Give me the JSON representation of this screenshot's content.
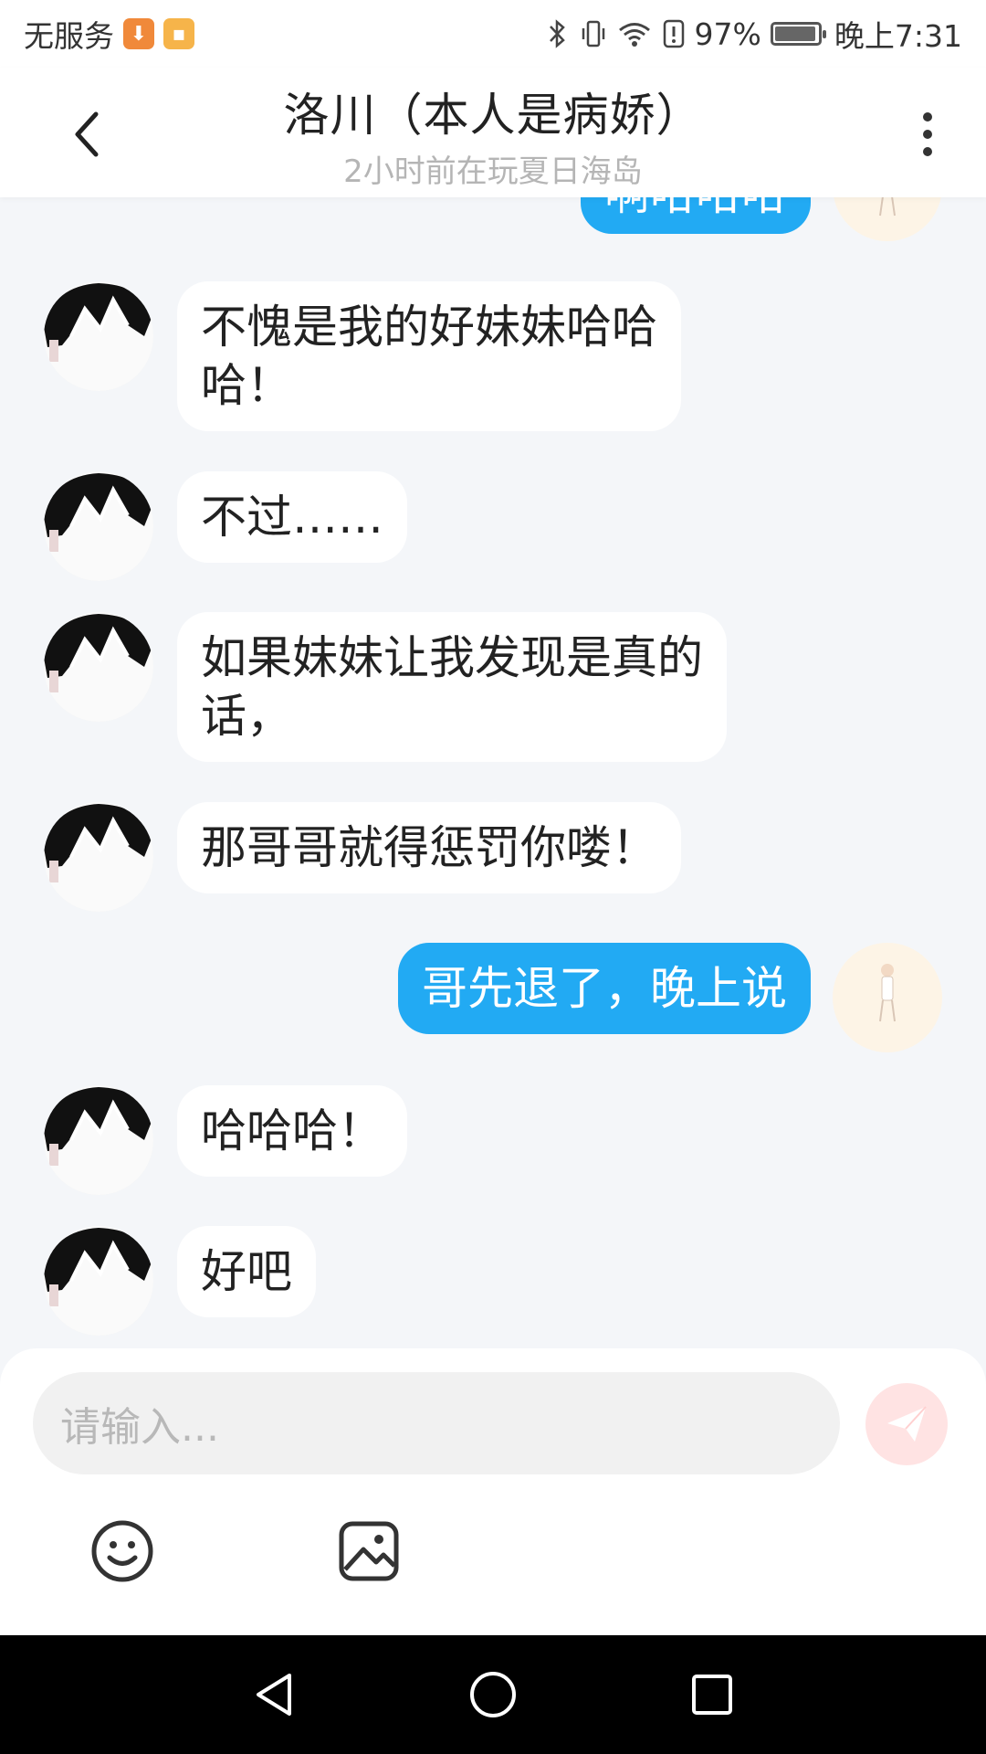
{
  "status_bar": {
    "carrier": "无服务",
    "battery": "97%",
    "time": "晚上7:31"
  },
  "header": {
    "title": "洛川（本人是病娇）",
    "subtitle": "2小时前在玩夏日海岛"
  },
  "messages": [
    {
      "side": "out",
      "text": "啊哈哈哈"
    },
    {
      "side": "in",
      "line1": "不愧是我的好妹妹哈哈",
      "line2": "哈！"
    },
    {
      "side": "in",
      "text": "不过……"
    },
    {
      "side": "in",
      "line1": "如果妹妹让我发现是真的",
      "line2": "话，"
    },
    {
      "side": "in",
      "text": "那哥哥就得惩罚你喽！"
    },
    {
      "side": "out",
      "text": "哥先退了，晚上说"
    },
    {
      "side": "in",
      "text": "哈哈哈！"
    },
    {
      "side": "in",
      "text": "好吧"
    }
  ],
  "input": {
    "placeholder": "请输入..."
  },
  "colors": {
    "outgoing_bubble": "#22aaf3",
    "incoming_bubble": "#ffffff",
    "chat_background": "#f4f6f9",
    "send_button": "#ffe3e3"
  },
  "icons": {
    "back": "chevron-left-icon",
    "more": "more-vertical-icon",
    "send": "paper-plane-icon",
    "emoji": "smiley-icon",
    "image": "image-icon",
    "nav_back": "triangle-back-icon",
    "nav_home": "circle-home-icon",
    "nav_recent": "square-recent-icon"
  }
}
